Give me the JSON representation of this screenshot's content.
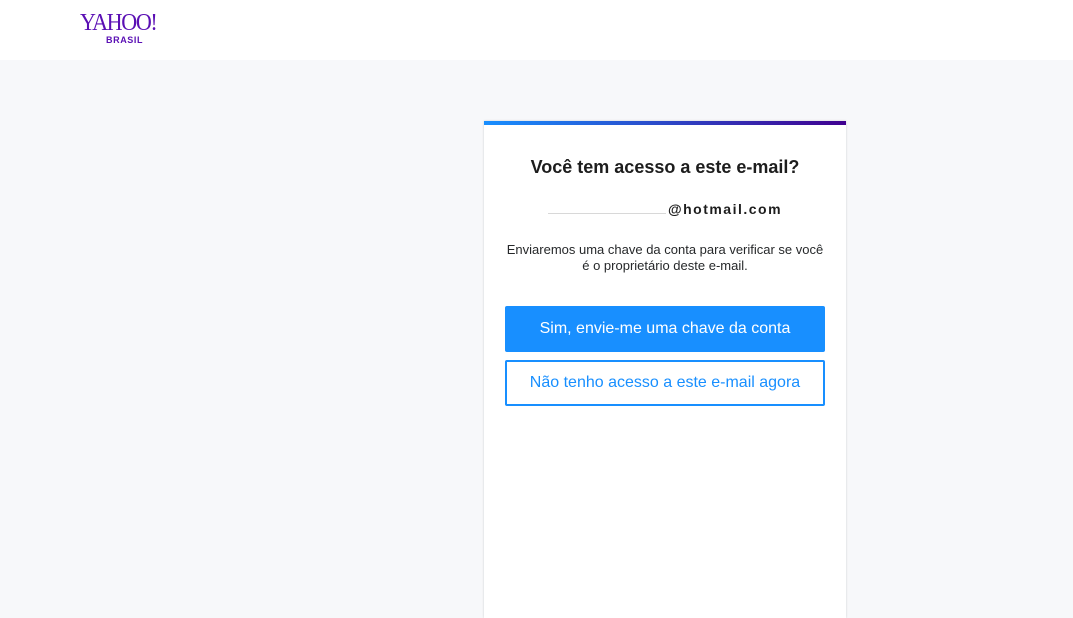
{
  "header": {
    "logo_text": "YAHOO!",
    "logo_region": "BRASIL"
  },
  "card": {
    "title": "Você tem acesso a este e-mail?",
    "email_domain": "@hotmail.com",
    "description": "Enviaremos uma chave da conta para verificar se você é o proprietário deste e-mail.",
    "primary_button": "Sim, envie-me uma chave da conta",
    "secondary_button": "Não tenho acesso a este e-mail agora"
  },
  "colors": {
    "brand_purple": "#5a0fb4",
    "accent_blue": "#188fff",
    "accent_gradient_end": "#400090",
    "page_background": "#f7f8fa"
  }
}
